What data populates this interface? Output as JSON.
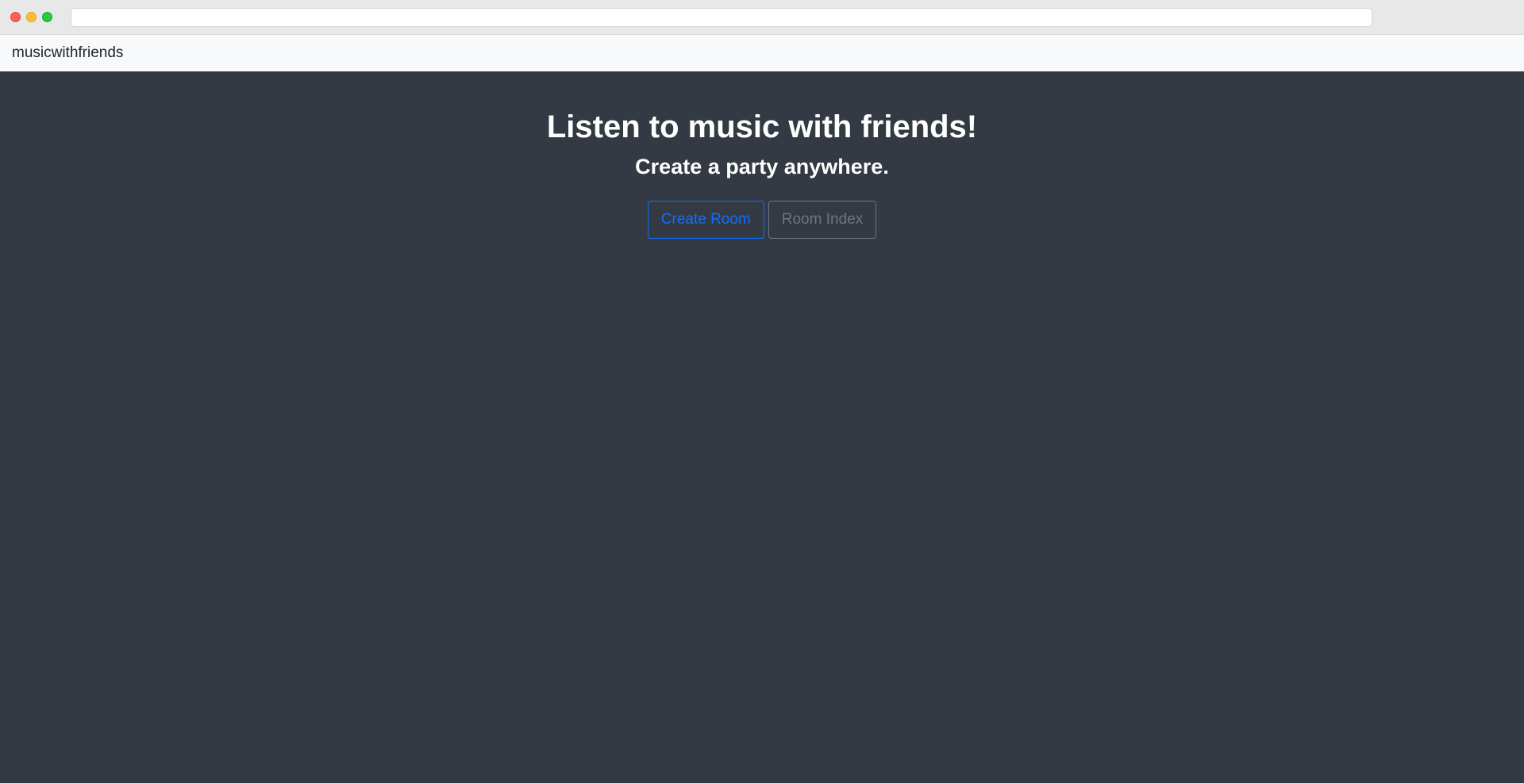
{
  "navbar": {
    "brand": "musicwithfriends"
  },
  "hero": {
    "title": "Listen to music with friends!",
    "subtitle": "Create a party anywhere."
  },
  "actions": {
    "create_room_label": "Create Room",
    "room_index_label": "Room Index"
  },
  "colors": {
    "background": "#343a43",
    "navbar_background": "#f8f9fa",
    "primary": "#0d6efd",
    "secondary": "#6c757d"
  }
}
